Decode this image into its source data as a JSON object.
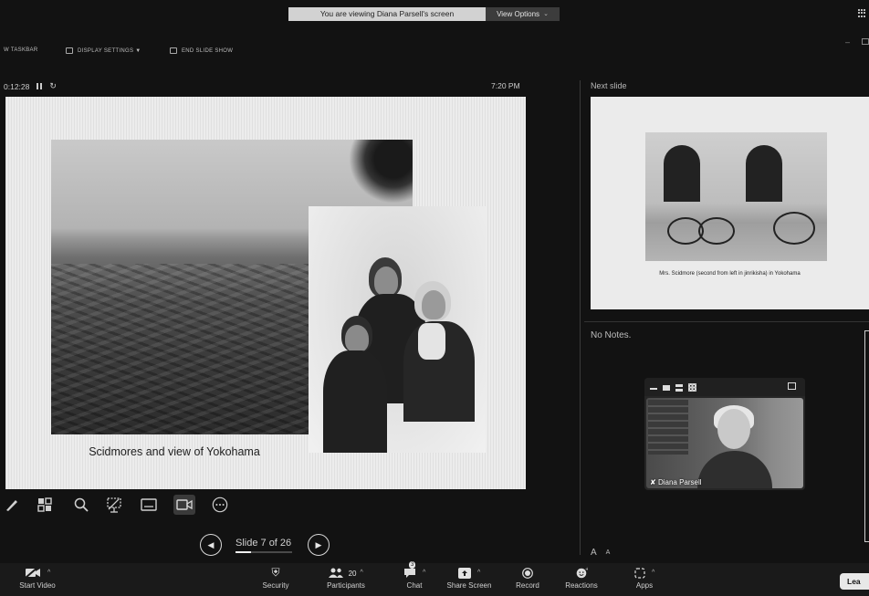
{
  "banner": {
    "message": "You are viewing Diana Parsell's screen",
    "view_options": "View Options"
  },
  "presenter_toolbar": {
    "taskbar": "W TASKBAR",
    "display_settings": "DISPLAY SETTINGS ▼",
    "end_show": "END SLIDE SHOW"
  },
  "timer": {
    "elapsed": "0:12:28",
    "clock": "7:20 PM"
  },
  "current_slide": {
    "caption": "Scidmores and  view of Yokohama"
  },
  "navigation": {
    "counter": "Slide 7 of 26",
    "current": 7,
    "total": 26,
    "progress_fraction": 0.27
  },
  "next_slide": {
    "label": "Next slide",
    "caption": "Mrs. Scidmore (second from left in jinrikisha) in Yokohama"
  },
  "notes": {
    "text": "No Notes."
  },
  "participant": {
    "name": "Diana Parsell"
  },
  "font_controls": {
    "increase": "A",
    "decrease": "A"
  },
  "meeting_bar": {
    "start_video": "Start Video",
    "security": "Security",
    "participants": "Participants",
    "participants_count": "20",
    "chat": "Chat",
    "chat_badge": "3",
    "share_screen": "Share Screen",
    "record": "Record",
    "reactions": "Reactions",
    "apps": "Apps",
    "leave": "Lea"
  },
  "icons": [
    "pen-icon",
    "slides-grid-icon",
    "zoom-icon",
    "laser-pointer-icon",
    "subtitles-icon",
    "camera-icon",
    "more-icon",
    "prev-icon",
    "next-icon",
    "video-off-icon",
    "shield-icon",
    "participants-icon",
    "chat-icon",
    "share-icon",
    "record-icon",
    "reactions-icon",
    "apps-icon"
  ],
  "colors": {
    "background": "#121212",
    "slide": "#ececec",
    "banner": "#d2d2d2",
    "meeting_bar": "#1a1a1a"
  }
}
